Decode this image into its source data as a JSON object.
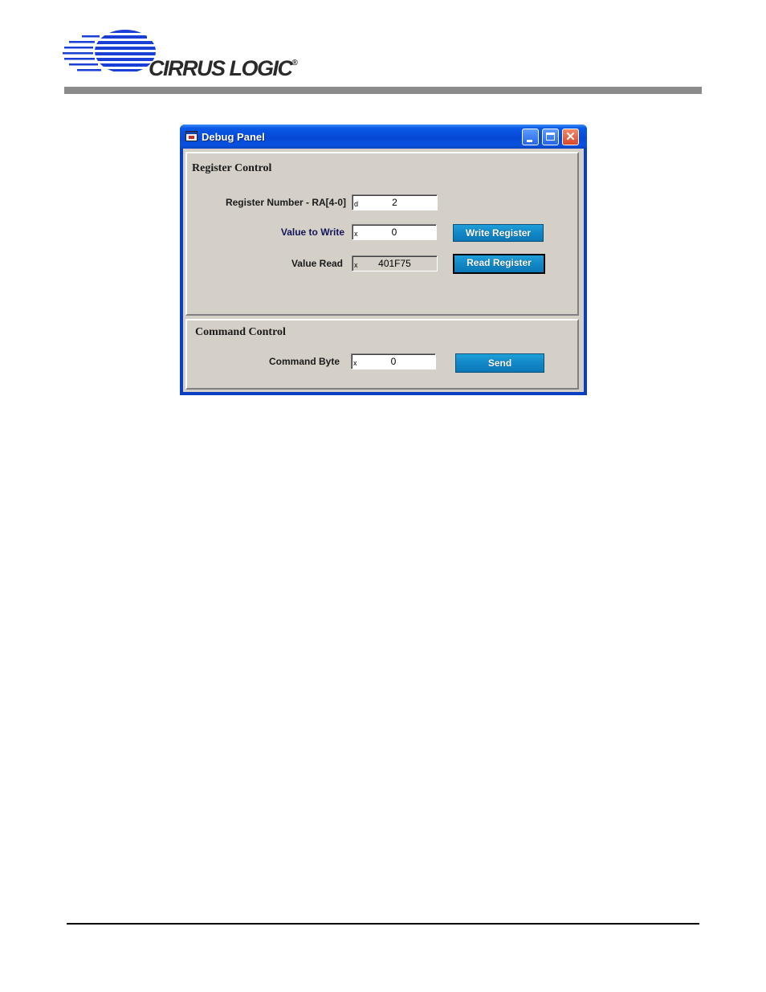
{
  "brand": {
    "name": "CIRRUS LOGIC",
    "mark": "®"
  },
  "window": {
    "title": "Debug Panel",
    "controls": {
      "minimize": "minimize",
      "maximize": "maximize",
      "close": "✕"
    }
  },
  "register_control": {
    "title": "Register Control",
    "register_number": {
      "label": "Register Number - RA[4-0]",
      "radix": "d",
      "value": "2"
    },
    "value_to_write": {
      "label": "Value to Write",
      "radix": "x",
      "value": "0"
    },
    "value_read": {
      "label": "Value Read",
      "radix": "x",
      "value": "401F75"
    },
    "write_button": "Write Register",
    "read_button": "Read Register"
  },
  "command_control": {
    "title": "Command Control",
    "command_byte": {
      "label": "Command Byte",
      "radix": "x",
      "value": "0"
    },
    "send_button": "Send"
  },
  "colors": {
    "titlebar": "#0648d6",
    "button": "#1287c7",
    "panel": "#d4d0c8",
    "logo_blue": "#1a3fd6"
  }
}
